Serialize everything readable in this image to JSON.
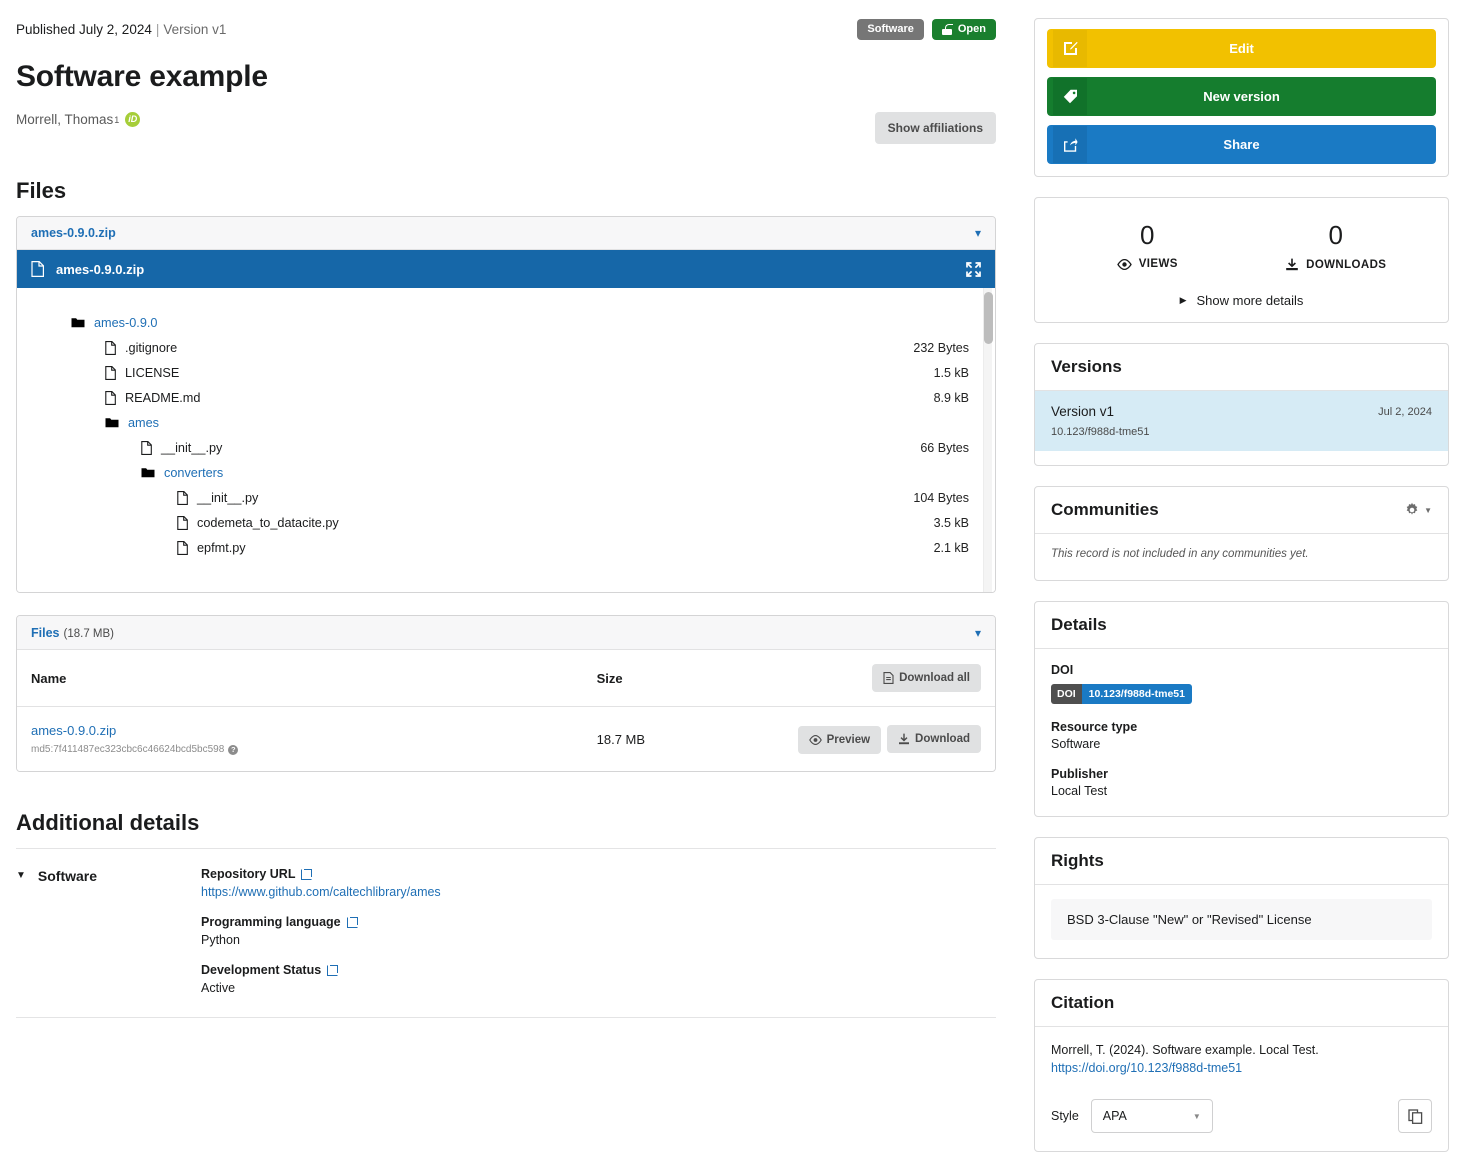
{
  "header": {
    "published": "Published July 2, 2024",
    "separator": "|",
    "version": "Version v1",
    "badge_type": "Software",
    "badge_access": "Open",
    "title": "Software example",
    "author": "Morrell, Thomas",
    "author_affiliation_marker": "1",
    "orcid_label": "iD",
    "show_affiliations": "Show affiliations"
  },
  "files_section": {
    "heading": "Files",
    "preview_header_file": "ames-0.9.0.zip",
    "preview_title_file": "ames-0.9.0.zip",
    "tree": [
      {
        "name": "ames-0.9.0",
        "size": "",
        "type": "folder",
        "indent": 0
      },
      {
        "name": ".gitignore",
        "size": "232 Bytes",
        "type": "file",
        "indent": 1
      },
      {
        "name": "LICENSE",
        "size": "1.5 kB",
        "type": "file",
        "indent": 1
      },
      {
        "name": "README.md",
        "size": "8.9 kB",
        "type": "file",
        "indent": 1
      },
      {
        "name": "ames",
        "size": "",
        "type": "folder",
        "indent": 1
      },
      {
        "name": "__init__.py",
        "size": "66 Bytes",
        "type": "file",
        "indent": 2
      },
      {
        "name": "converters",
        "size": "",
        "type": "folder",
        "indent": 2
      },
      {
        "name": "__init__.py",
        "size": "104 Bytes",
        "type": "file",
        "indent": 3
      },
      {
        "name": "codemeta_to_datacite.py",
        "size": "3.5 kB",
        "type": "file",
        "indent": 3
      },
      {
        "name": "epfmt.py",
        "size": "2.1 kB",
        "type": "file",
        "indent": 3
      }
    ],
    "table_label": "Files",
    "table_total_size": "(18.7 MB)",
    "columns": {
      "name": "Name",
      "size": "Size"
    },
    "download_all": "Download all",
    "rows": [
      {
        "name": "ames-0.9.0.zip",
        "checksum": "md5:7f411487ec323cbc6c46624bcd5bc598",
        "size": "18.7 MB",
        "preview": "Preview",
        "download": "Download"
      }
    ]
  },
  "additional_details": {
    "heading": "Additional details",
    "group_label": "Software",
    "items": [
      {
        "label": "Repository URL",
        "value": "https://www.github.com/caltechlibrary/ames",
        "is_link": true
      },
      {
        "label": "Programming language",
        "value": "Python",
        "is_link": false
      },
      {
        "label": "Development Status",
        "value": "Active",
        "is_link": false
      }
    ]
  },
  "sidebar": {
    "actions": [
      {
        "label": "Edit",
        "icon": "edit-icon",
        "color": "#f2c100"
      },
      {
        "label": "New version",
        "icon": "tag-icon",
        "color": "#157d2e"
      },
      {
        "label": "Share",
        "icon": "share-icon",
        "color": "#1a7ac4"
      }
    ],
    "stats": {
      "views_count": "0",
      "views_label": "VIEWS",
      "downloads_count": "0",
      "downloads_label": "DOWNLOADS",
      "show_more": "Show more details"
    },
    "versions": {
      "heading": "Versions",
      "items": [
        {
          "name": "Version v1",
          "doi": "10.123/f988d-tme51",
          "date": "Jul 2, 2024"
        }
      ]
    },
    "communities": {
      "heading": "Communities",
      "empty_text": "This record is not included in any communities yet."
    },
    "details": {
      "heading": "Details",
      "doi_label": "DOI",
      "doi_badge_key": "DOI",
      "doi_badge_value": "10.123/f988d-tme51",
      "resource_type_label": "Resource type",
      "resource_type_value": "Software",
      "publisher_label": "Publisher",
      "publisher_value": "Local Test"
    },
    "rights": {
      "heading": "Rights",
      "license": "BSD 3-Clause \"New\" or \"Revised\" License"
    },
    "citation": {
      "heading": "Citation",
      "text": "Morrell, T. (2024). Software example. Local Test.",
      "link": "https://doi.org/10.123/f988d-tme51",
      "style_label": "Style",
      "style_value": "APA"
    }
  }
}
